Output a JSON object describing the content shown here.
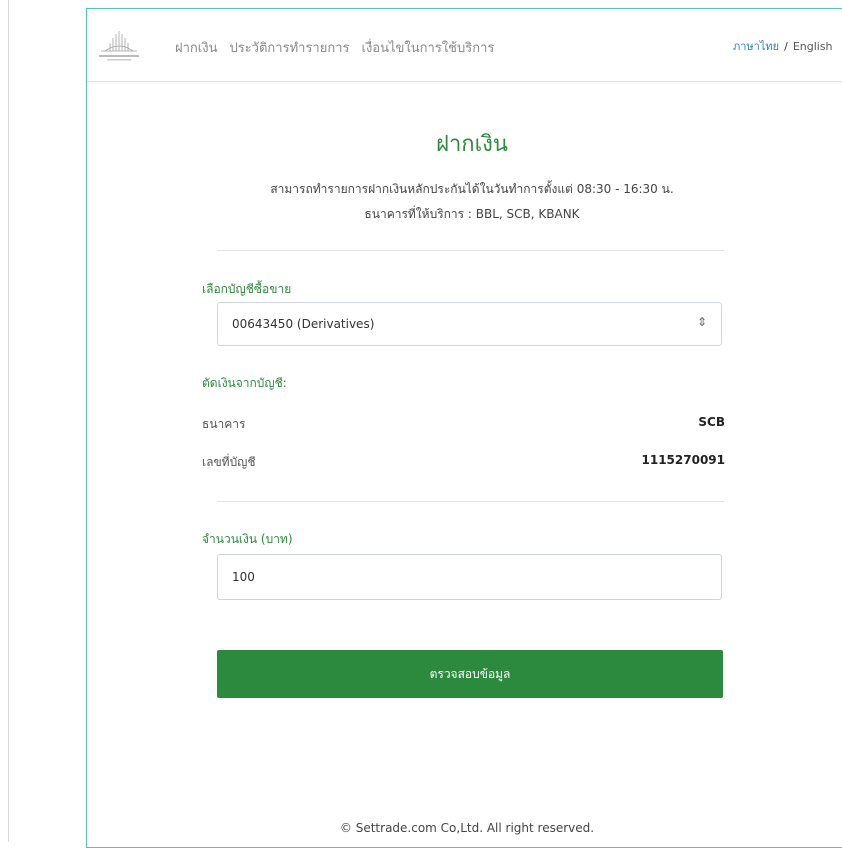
{
  "nav": {
    "logo_text": "SETTRADE GROUP",
    "menu": [
      "ฝากเงิน",
      "ประวัติการทำรายการ",
      "เงื่อนไขในการใช้บริการ"
    ],
    "lang_thai": "ภาษาไทย",
    "lang_sep": "/",
    "lang_english": "English"
  },
  "page": {
    "title": "ฝากเงิน",
    "description_1": "สามารถทำรายการฝากเงินหลักประกันได้ในวันทำการตั้งแต่ 08:30 - 16:30 น.",
    "description_2": "ธนาคารที่ให้บริการ : BBL, SCB, KBANK"
  },
  "form": {
    "account_label": "เลือกบัญชีซื้อขาย",
    "account_selected": "00643450 (Derivatives)",
    "debit_label": "ตัดเงินจากบัญชี:",
    "bank_label": "ธนาคาร",
    "bank_value": "SCB",
    "account_no_label": "เลขที่บัญชี",
    "account_no_value": "1115270091",
    "amount_label": "จำนวนเงิน (บาท)",
    "amount_value": "100",
    "submit_label": "ตรวจสอบข้อมูล"
  },
  "footer": {
    "copyright": "© Settrade.com Co,Ltd. All right reserved."
  },
  "colors": {
    "accent_green": "#2b8a3e",
    "link_blue": "#2f7fd1",
    "frame_teal": "#54c6b6"
  }
}
